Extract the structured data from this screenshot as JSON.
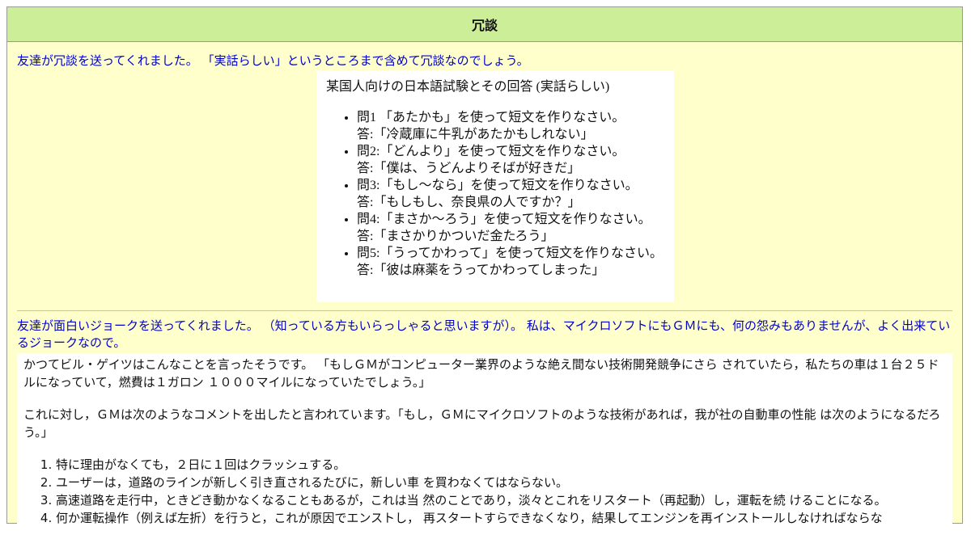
{
  "title": "冗談",
  "section1": {
    "intro": "友達が冗談を送ってくれました。 「実話らしい」というところまで含めて冗談なのでしょう。",
    "heading": "某国人向けの日本語試験とその回答 (実話らしい)",
    "items": [
      {
        "q": "問1 「あたかも」を使って短文を作りなさい。",
        "a": "答:「冷蔵庫に牛乳があたかもしれない」"
      },
      {
        "q": "問2:「どんより」を使って短文を作りなさい。",
        "a": "答:「僕は、うどんよりそばが好きだ」"
      },
      {
        "q": "問3:「もし～なら」を使って短文を作りなさい。",
        "a": "答:「もしもし、奈良県の人ですか？」"
      },
      {
        "q": "問4:「まさか～ろう」を使って短文を作りなさい。",
        "a": "答:「まさかりかついだ金たろう」"
      },
      {
        "q": "問5:「うってかわって」を使って短文を作りなさい。",
        "a": "答:「彼は麻薬をうってかわってしまった」"
      }
    ]
  },
  "section2": {
    "intro": "友達が面白いジョークを送ってくれました。 （知っている方もいらっしゃると思いますが）。 私は、マイクロソフトにもＧＭにも、何の怨みもありませんが、よく出来てい るジョークなので。",
    "para1": "かつてビル・ゲイツはこんなことを言ったそうです。 「もしＧＭがコンピューター業界のような絶え間ない技術開発競争にさら されていたら，私たちの車は１台２５ドルになっていて，燃費は１ガロン １０００マイルになっていたでしょう。」",
    "para2": "これに対し，ＧＭは次のようなコメントを出したと言われています。「もし，ＧＭにマイクロソフトのような技術があれば，我が社の自動車の性能 は次のようになるだろう。」",
    "list": [
      "特に理由がなくても，２日に１回はクラッシュする。",
      "ユーザーは，道路のラインが新しく引き直されるたびに，新しい車 を買わなくてはならない。",
      "高速道路を走行中，ときどき動かなくなることもあるが，これは当 然のことであり，淡々とこれをリスタート（再起動）し，運転を続 けることになる。",
      "何か運転操作（例えば左折）を行うと，これが原因でエンストし， 再スタートすらできなくなり，結果してエンジンを再インストールしなければならな"
    ]
  }
}
